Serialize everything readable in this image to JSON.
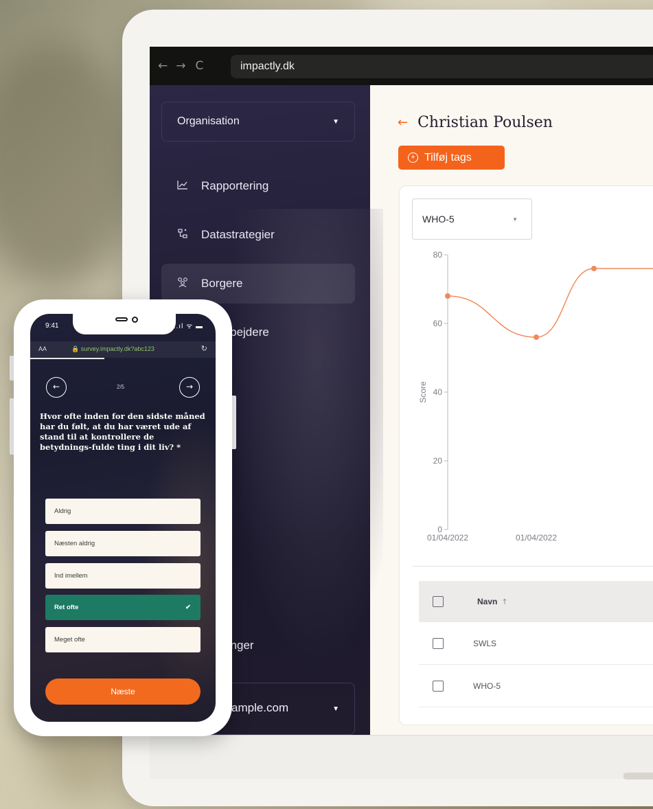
{
  "browser": {
    "nav_back": "←",
    "nav_forward": "→",
    "nav_reload": "C",
    "url": "impactly.dk"
  },
  "sidebar": {
    "org_select": "Organisation",
    "items": [
      {
        "label": "Rapportering",
        "icon": "chart-trend-icon"
      },
      {
        "label": "Datastrategier",
        "icon": "strategy-icon"
      },
      {
        "label": "Borgere",
        "icon": "people-icon",
        "active": true
      },
      {
        "label": "arbejdere",
        "icon": "users-icon"
      }
    ],
    "partial_item": "linger",
    "account_email": "ample.com"
  },
  "main": {
    "title": "Christian Poulsen",
    "add_tags": "Tilføj tags",
    "measure_select": "WHO-5"
  },
  "chart_data": {
    "type": "line",
    "ylabel": "Score",
    "ylim": [
      0,
      80
    ],
    "yticks": [
      0,
      20,
      40,
      60,
      80
    ],
    "x_tick_labels": [
      "01/04/2022",
      "01/04/2022"
    ],
    "color": "#f08a5d",
    "series": [
      {
        "values": [
          68,
          56,
          76,
          76
        ]
      }
    ]
  },
  "table": {
    "header_name": "Navn",
    "sort_icon": "↑",
    "rows": [
      {
        "name": "SWLS"
      },
      {
        "name": "WHO-5"
      }
    ]
  },
  "phone": {
    "time": "9:41",
    "signal": "..ıl ᯤ ▬",
    "aa": "AA",
    "url": "🔒 survey.impactly.dk?abc123",
    "reload": "↻",
    "step": "2/5",
    "prev": "←",
    "next_arrow": "→",
    "question": "Hvor ofte inden for den sidste måned har du følt, at du har været ude af stand til at kontrollere de betydnings-fulde ting i dit liv? *",
    "options": [
      {
        "label": "Aldrig",
        "selected": false
      },
      {
        "label": "Næsten aldrig",
        "selected": false
      },
      {
        "label": "Ind imellem",
        "selected": false
      },
      {
        "label": "Ret ofte",
        "selected": true
      },
      {
        "label": "Meget ofte",
        "selected": false
      }
    ],
    "check": "✔",
    "next_button": "Næste"
  }
}
